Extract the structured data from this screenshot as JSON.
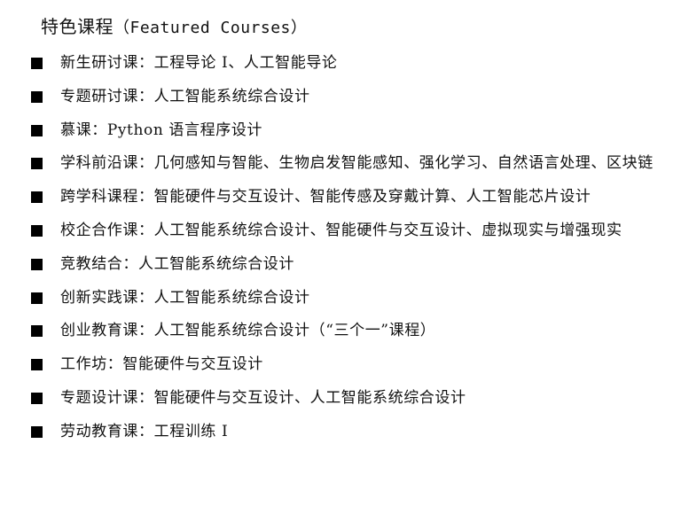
{
  "title": {
    "zh": "特色课程",
    "en": "（Featured Courses）"
  },
  "courses": [
    {
      "category": "新生研讨课：",
      "content": "工程导论 I、人工智能导论"
    },
    {
      "category": "专题研讨课：",
      "content": "人工智能系统综合设计"
    },
    {
      "category": "慕课：",
      "content": "Python 语言程序设计"
    },
    {
      "category": "学科前沿课：",
      "content": "几何感知与智能、生物启发智能感知、强化学习、自然语言处理、区块链"
    },
    {
      "category": "跨学科课程：",
      "content": "智能硬件与交互设计、智能传感及穿戴计算、人工智能芯片设计"
    },
    {
      "category": "校企合作课：",
      "content": "人工智能系统综合设计、智能硬件与交互设计、虚拟现实与增强现实"
    },
    {
      "category": "竞教结合：",
      "content": "人工智能系统综合设计"
    },
    {
      "category": "创新实践课：",
      "content": "人工智能系统综合设计"
    },
    {
      "category": "创业教育课：",
      "content": "人工智能系统综合设计（“三个一”课程）"
    },
    {
      "category": "工作坊：",
      "content": "智能硬件与交互设计"
    },
    {
      "category": "专题设计课：",
      "content": "智能硬件与交互设计、人工智能系统综合设计"
    },
    {
      "category": "劳动教育课：",
      "content": "工程训练 I"
    }
  ]
}
